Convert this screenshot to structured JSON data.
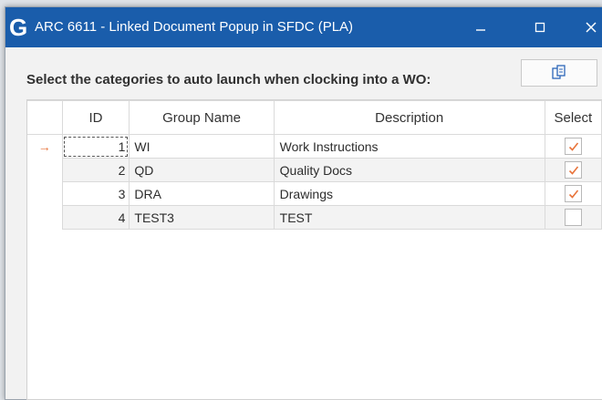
{
  "window": {
    "logo": "G",
    "title": "ARC 6611 - Linked Document Popup in SFDC (PLA)"
  },
  "prompt": "Select the categories to auto launch when clocking into a WO:",
  "toolbar": {
    "launch_icon": "open-documents-icon"
  },
  "grid": {
    "columns": [
      "ID",
      "Group Name",
      "Description",
      "Select"
    ],
    "current_row_indicator": "→",
    "rows": [
      {
        "id": "1",
        "group": "WI",
        "description": "Work Instructions",
        "selected": true
      },
      {
        "id": "2",
        "group": "QD",
        "description": "Quality Docs",
        "selected": true
      },
      {
        "id": "3",
        "group": "DRA",
        "description": "Drawings",
        "selected": true
      },
      {
        "id": "4",
        "group": "TEST3",
        "description": "TEST",
        "selected": false
      }
    ]
  },
  "colors": {
    "titlebar": "#1a5dab",
    "check": "#e8743b",
    "indicator": "#e8743b"
  }
}
